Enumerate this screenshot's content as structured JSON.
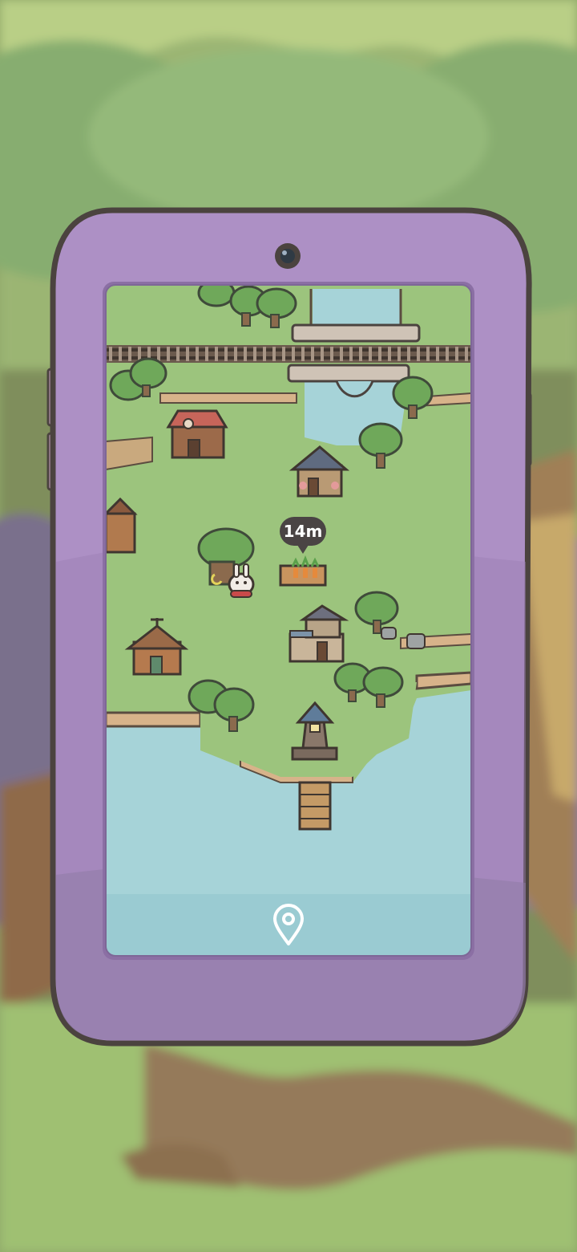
{
  "map": {
    "timer_label": "14m"
  },
  "icons": {
    "location": "location-pin-icon",
    "camera": "camera-lens-icon"
  },
  "colors": {
    "phone_case": "#ad90c5",
    "screen_grass": "#9cc47d",
    "water": "#a6d3d8",
    "outline": "#4b433f",
    "bubble": "#4a4444"
  }
}
